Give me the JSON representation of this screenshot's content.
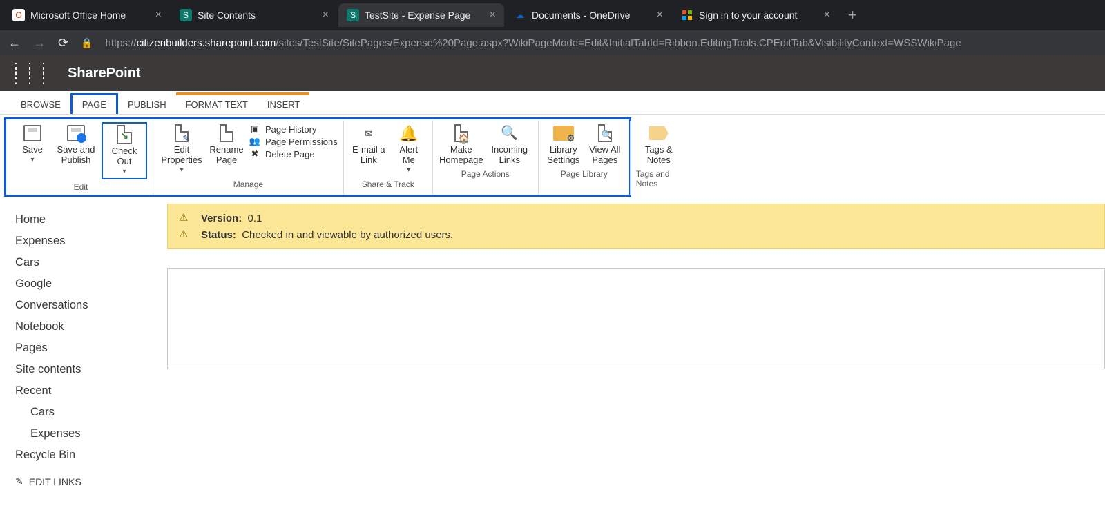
{
  "browser": {
    "tabs": [
      {
        "title": "Microsoft Office Home",
        "icon_bg": "#ffffff",
        "icon_fg": "#d83b01",
        "glyph": "O"
      },
      {
        "title": "Site Contents",
        "icon_bg": "#0e7a6e",
        "icon_fg": "#fff",
        "glyph": "S"
      },
      {
        "title": "TestSite - Expense Page",
        "icon_bg": "#0e7a6e",
        "icon_fg": "#fff",
        "glyph": "S",
        "active": true
      },
      {
        "title": "Documents - OneDrive",
        "icon_bg": "#ffffff",
        "icon_fg": "#0a66c2",
        "glyph": "☁"
      },
      {
        "title": "Sign in to your account",
        "icon_bg": "#ffffff",
        "icon_fg": "#000",
        "glyph": "⊞"
      }
    ],
    "url_bold": "citizenbuilders.sharepoint.com",
    "url_rest": "/sites/TestSite/SitePages/Expense%20Page.aspx?WikiPageMode=Edit&InitialTabId=Ribbon.EditingTools.CPEditTab&VisibilityContext=WSSWikiPage",
    "url_prefix": "https://"
  },
  "suitebar": {
    "app": "SharePoint"
  },
  "ribbon_tabs": [
    "BROWSE",
    "PAGE",
    "PUBLISH",
    "FORMAT TEXT",
    "INSERT"
  ],
  "ribbon_tabs_selected": "PAGE",
  "ribbon": {
    "edit": {
      "label": "Edit",
      "save": "Save",
      "save_publish": "Save and Publish",
      "checkout": "Check Out"
    },
    "manage": {
      "label": "Manage",
      "edit_properties": "Edit Properties",
      "rename": "Rename Page",
      "history": "Page History",
      "permissions": "Page Permissions",
      "delete": "Delete Page"
    },
    "share": {
      "label": "Share & Track",
      "email": "E-mail a Link",
      "alert": "Alert Me"
    },
    "actions": {
      "label": "Page Actions",
      "home": "Make Homepage",
      "incoming": "Incoming Links"
    },
    "library": {
      "label": "Page Library",
      "settings": "Library Settings",
      "viewall": "View All Pages"
    },
    "tags": {
      "label": "Tags and Notes",
      "tags": "Tags & Notes"
    }
  },
  "leftnav": {
    "items": [
      "Home",
      "Expenses",
      "Cars",
      "Google",
      "Conversations",
      "Notebook",
      "Pages",
      "Site contents",
      "Recent"
    ],
    "recent_items": [
      "Cars",
      "Expenses"
    ],
    "recycle": "Recycle Bin",
    "edit_links": "EDIT LINKS"
  },
  "status": {
    "version_label": "Version:",
    "version_value": "0.1",
    "status_label": "Status:",
    "status_value": "Checked in and viewable by authorized users."
  }
}
